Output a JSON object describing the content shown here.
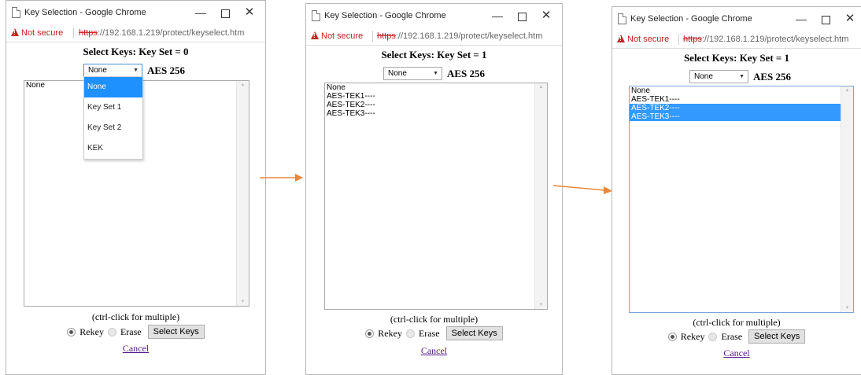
{
  "windows": [
    {
      "title": "Key Selection - Google Chrome",
      "address": {
        "warning": "Not secure",
        "scheme": "https",
        "rest": "://192.168.1.219/protect/keyselect.htm"
      },
      "heading": "Select Keys: Key Set = 0",
      "select_value": "None",
      "cipher": "AES 256",
      "list_items": [
        "None"
      ],
      "dropdown_open": true,
      "dropdown_options": [
        "None",
        "Key Set 1",
        "Key Set 2",
        "KEK"
      ],
      "dropdown_selected": "None",
      "hint": "(ctrl-click for multiple)",
      "rekey_label": "Rekey",
      "erase_label": "Erase",
      "select_button": "Select Keys",
      "cancel_link": "Cancel"
    },
    {
      "title": "Key Selection - Google Chrome",
      "address": {
        "warning": "Not secure",
        "scheme": "https",
        "rest": "://192.168.1.219/protect/keyselect.htm"
      },
      "heading": "Select Keys: Key Set = 1",
      "select_value": "None",
      "cipher": "AES 256",
      "list_items": [
        "None",
        "AES-TEK1----",
        "AES-TEK2----",
        "AES-TEK3----"
      ],
      "selected_items": [],
      "hint": "(ctrl-click for multiple)",
      "rekey_label": "Rekey",
      "erase_label": "Erase",
      "select_button": "Select Keys",
      "cancel_link": "Cancel"
    },
    {
      "title": "Key Selection - Google Chrome",
      "address": {
        "warning": "Not secure",
        "scheme": "https",
        "rest": "://192.168.1.219/protect/keyselect.htm"
      },
      "heading": "Select Keys: Key Set = 1",
      "select_value": "None",
      "cipher": "AES 256",
      "list_items": [
        "None",
        "AES-TEK1----",
        "AES-TEK2----",
        "AES-TEK3----"
      ],
      "selected_items": [
        "AES-TEK2----",
        "AES-TEK3----"
      ],
      "hint": "(ctrl-click for multiple)",
      "rekey_label": "Rekey",
      "erase_label": "Erase",
      "select_button": "Select Keys",
      "cancel_link": "Cancel"
    }
  ],
  "colors": {
    "arrow": "#e8873a",
    "selection": "#3399ff",
    "warning": "#c5221f",
    "link": "#551a8b"
  },
  "icons": [
    "page-icon",
    "warning-icon",
    "minimize-icon",
    "maximize-icon",
    "close-icon",
    "dropdown-arrow-icon",
    "scroll-up-icon",
    "scroll-down-icon",
    "radio-icon",
    "arrow-icon"
  ]
}
